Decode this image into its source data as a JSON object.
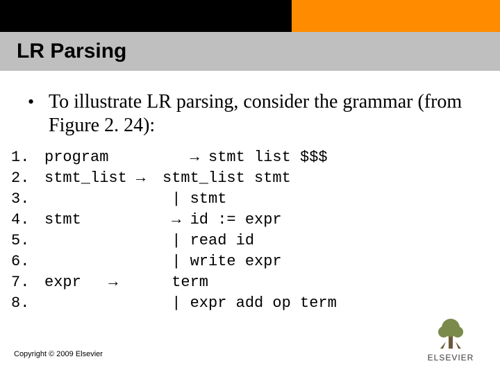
{
  "title": "LR Parsing",
  "bullet": {
    "marker": "•",
    "text": "To illustrate LR parsing, consider the grammar (from Figure 2. 24):"
  },
  "grammar": [
    {
      "n": "1.",
      "lhs": "program",
      "rhs": "   → stmt list $$$"
    },
    {
      "n": "2.",
      "lhs": "stmt_list →",
      "rhs": "stmt_list stmt"
    },
    {
      "n": "3.",
      "lhs": "",
      "rhs": " | stmt"
    },
    {
      "n": "4.",
      "lhs": "stmt",
      "rhs": " → id := expr"
    },
    {
      "n": "5.",
      "lhs": "",
      "rhs": " | read id"
    },
    {
      "n": "6.",
      "lhs": "",
      "rhs": " | write expr"
    },
    {
      "n": "7.",
      "lhs": "expr   →",
      "rhs": " term"
    },
    {
      "n": "8.",
      "lhs": "",
      "rhs": " | expr add op term"
    }
  ],
  "copyright": "Copyright © 2009 Elsevier",
  "logo": {
    "brand": "ELSEVIER"
  }
}
